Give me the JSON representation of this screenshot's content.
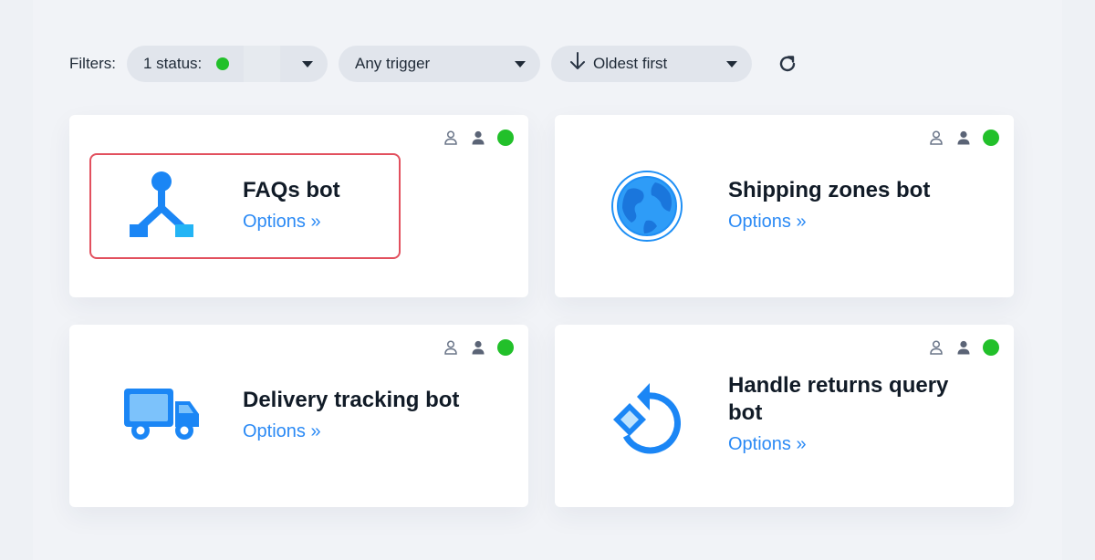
{
  "filters": {
    "label": "Filters:",
    "status_label": "1 status:",
    "status_color": "#22c02a",
    "trigger_label": "Any trigger",
    "sort_label": "Oldest first",
    "refresh_icon": "refresh-icon"
  },
  "colors": {
    "accent": "#2b8af5",
    "active": "#22c02a",
    "highlight": "#e2505e"
  },
  "bots": [
    {
      "title": "FAQs bot",
      "link": "Options »",
      "icon": "branch-icon"
    },
    {
      "title": "Shipping zones bot",
      "link": "Options »",
      "icon": "globe-icon"
    },
    {
      "title": "Delivery tracking bot",
      "link": "Options »",
      "icon": "truck-icon"
    },
    {
      "title": "Handle returns query bot",
      "link": "Options »",
      "icon": "return-icon"
    }
  ]
}
